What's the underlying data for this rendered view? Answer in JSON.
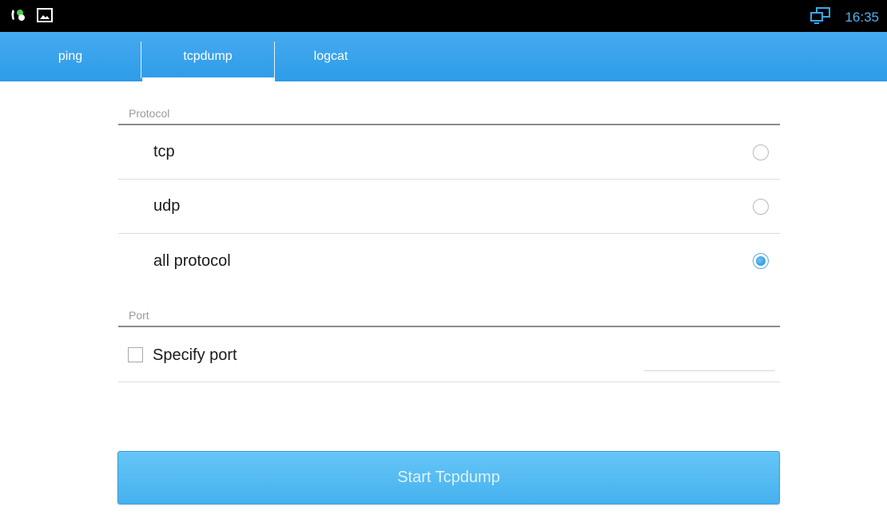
{
  "status_bar": {
    "time": "16:35",
    "icons": [
      "call-forward-icon",
      "image-icon",
      "network-icon"
    ]
  },
  "tabs": [
    {
      "label": "ping",
      "selected": false
    },
    {
      "label": "tcpdump",
      "selected": true
    },
    {
      "label": "logcat",
      "selected": false
    }
  ],
  "protocol": {
    "header": "Protocol",
    "options": [
      {
        "label": "tcp",
        "checked": false
      },
      {
        "label": "udp",
        "checked": false
      },
      {
        "label": "all protocol",
        "checked": true
      }
    ]
  },
  "port": {
    "header": "Port",
    "specify_label": "Specify port",
    "specify_checked": false,
    "value": ""
  },
  "actions": {
    "start_label": "Start Tcpdump"
  },
  "colors": {
    "accent": "#2e9ce8",
    "button": "#52b7f1",
    "status_bar": "#000000"
  }
}
